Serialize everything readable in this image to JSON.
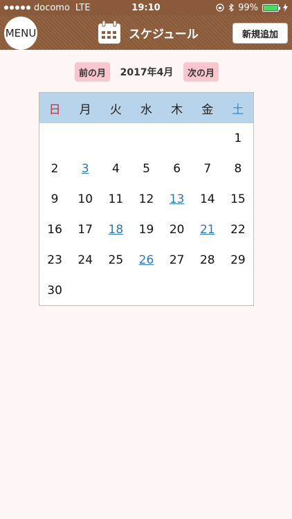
{
  "status_bar": {
    "carrier": "docomo",
    "network": "LTE",
    "time": "19:10",
    "battery": "99%",
    "battery_level": 0.99
  },
  "nav": {
    "menu_label": "MENU",
    "title": "スケジュール",
    "new_label": "新規追加"
  },
  "month_nav": {
    "prev_label": "前の月",
    "current": "2017年4月",
    "next_label": "次の月"
  },
  "calendar": {
    "weekdays": [
      "日",
      "月",
      "火",
      "水",
      "木",
      "金",
      "土"
    ],
    "weeks": [
      [
        "",
        "",
        "",
        "",
        "",
        "",
        "1"
      ],
      [
        "2",
        "3",
        "4",
        "5",
        "6",
        "7",
        "8"
      ],
      [
        "9",
        "10",
        "11",
        "12",
        "13",
        "14",
        "15"
      ],
      [
        "16",
        "17",
        "18",
        "19",
        "20",
        "21",
        "22"
      ],
      [
        "23",
        "24",
        "25",
        "26",
        "27",
        "28",
        "29"
      ],
      [
        "30",
        "",
        "",
        "",
        "",
        "",
        ""
      ]
    ],
    "event_days": [
      "3",
      "13",
      "18",
      "21",
      "26"
    ]
  },
  "colors": {
    "nav_brown": "#8e5d3b",
    "header_blue": "#b8d4ea",
    "sunday_red": "#e2242d",
    "saturday_blue": "#2a8de0",
    "event_link": "#2a7ab8",
    "month_button_pink": "#f7c6cf"
  },
  "icons": {
    "menu": "menu-button",
    "title": "calendar-icon",
    "bluetooth": "bluetooth-icon",
    "lock": "rotation-lock-icon",
    "battery": "battery-icon",
    "charge": "charging-bolt-icon"
  }
}
